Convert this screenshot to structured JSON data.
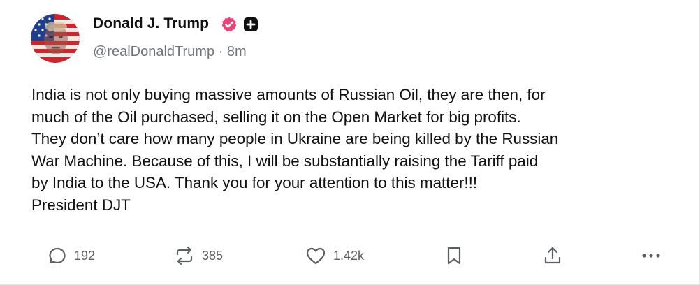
{
  "post": {
    "author": {
      "display_name": "Donald J. Trump",
      "handle": "@realDonaldTrump",
      "separator": "·",
      "time_ago": "8m",
      "verified_color": "#e8457a",
      "avatar_icon": "flag-portrait-avatar",
      "badges": [
        "verified-badge-icon",
        "plus-square-badge-icon"
      ]
    },
    "text_lines": [
      "India is not only buying massive amounts of Russian Oil, they are then, for",
      "much of the Oil purchased, selling it on the Open Market for big profits.",
      "They don’t care how many people in Ukraine are being killed by the Russian",
      "War Machine. Because of this, I will be substantially raising the Tariff paid",
      "by India to the USA. Thank you for your attention to this matter!!!",
      "President DJT"
    ],
    "actions": {
      "reply": {
        "icon": "reply-bubble-icon",
        "count": "192"
      },
      "repost": {
        "icon": "repost-arrows-icon",
        "count": "385"
      },
      "like": {
        "icon": "heart-icon",
        "count": "1.42k"
      },
      "bookmark": {
        "icon": "bookmark-icon"
      },
      "share": {
        "icon": "share-upload-icon"
      },
      "more": {
        "icon": "more-dots-icon"
      }
    }
  }
}
